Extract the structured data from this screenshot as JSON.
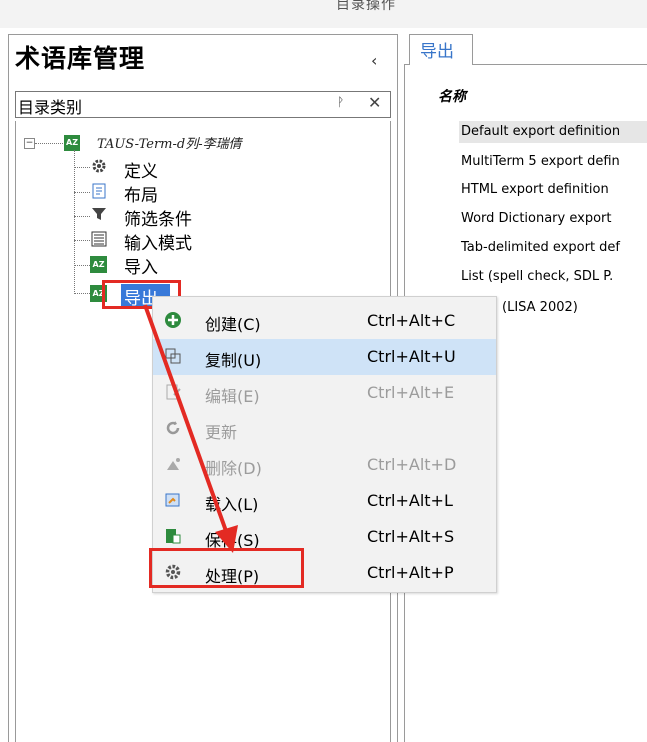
{
  "window": {
    "title": "目录操作"
  },
  "left": {
    "title": "术语库管理",
    "collapse_glyph": "‹",
    "category_header": "目录类别",
    "pin_glyph": "ᚹ",
    "close_glyph": "✕",
    "tree": {
      "root_label": "TAUS-Term-d列-李瑞倩",
      "root_icon_text": "AZ",
      "nodes": [
        {
          "label": "定义",
          "icon": "gear-icon"
        },
        {
          "label": "布局",
          "icon": "document-icon"
        },
        {
          "label": "筛选条件",
          "icon": "filter-icon"
        },
        {
          "label": "输入模式",
          "icon": "form-icon"
        },
        {
          "label": "导入",
          "icon": "import-icon"
        },
        {
          "label": "导出",
          "icon": "export-icon",
          "selected": true
        }
      ]
    }
  },
  "right": {
    "tab_label": "导出",
    "column_header": "名称",
    "items": [
      "Default export definition",
      "MultiTerm 5 export defin",
      "HTML export definition",
      "Word Dictionary export",
      "Tab-delimited export def",
      "List (spell check, SDL P.",
      "(LISA 2002)"
    ]
  },
  "context_menu": {
    "items": [
      {
        "label": "创建(C)",
        "shortcut": "Ctrl+Alt+C",
        "icon": "plus-icon",
        "enabled": true
      },
      {
        "label": "复制(U)",
        "shortcut": "Ctrl+Alt+U",
        "icon": "copy-icon",
        "enabled": true,
        "highlighted": true
      },
      {
        "label": "编辑(E)",
        "shortcut": "Ctrl+Alt+E",
        "icon": "edit-icon",
        "enabled": false
      },
      {
        "label": "更新",
        "shortcut": "",
        "icon": "refresh-icon",
        "enabled": false
      },
      {
        "label": "删除(D)",
        "shortcut": "Ctrl+Alt+D",
        "icon": "delete-icon",
        "enabled": false
      },
      {
        "label": "载入(L)",
        "shortcut": "Ctrl+Alt+L",
        "icon": "load-icon",
        "enabled": true
      },
      {
        "label": "保存(S)",
        "shortcut": "Ctrl+Alt+S",
        "icon": "save-icon",
        "enabled": true
      },
      {
        "label": "处理(P)",
        "shortcut": "Ctrl+Alt+P",
        "icon": "process-gear-icon",
        "enabled": true
      }
    ]
  },
  "colors": {
    "accent": "#3879d9",
    "highlight": "#e32a23",
    "menu_hover": "#cfe3f7",
    "tree_icon_green": "#2e8b3e"
  }
}
